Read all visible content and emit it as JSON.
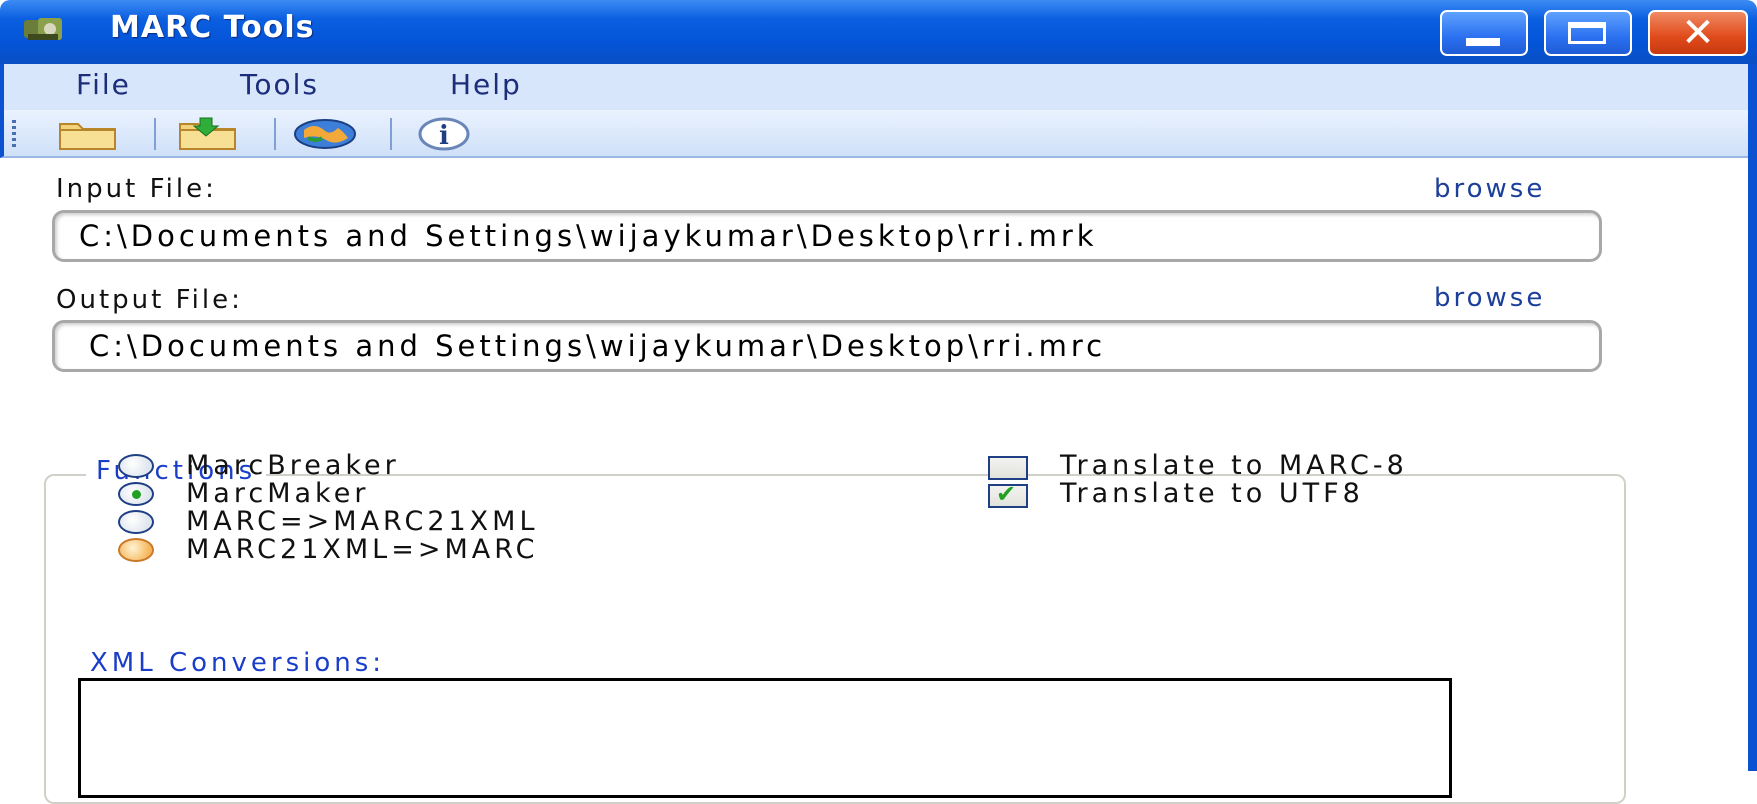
{
  "window": {
    "title": "MARC Tools",
    "close_glyph": "✕"
  },
  "menu": {
    "items": [
      "File",
      "Tools",
      "Help"
    ]
  },
  "toolbar": {
    "buttons": [
      "open-folder-icon",
      "save-folder-icon",
      "globe-icon",
      "info-icon"
    ]
  },
  "input_file": {
    "label": "Input File:",
    "browse": "browse",
    "value": "C:\\Documents and Settings\\wijaykumar\\Desktop\\rri.mrk"
  },
  "output_file": {
    "label": "Output File:",
    "browse": "browse",
    "value": "C:\\Documents and Settings\\wijaykumar\\Desktop\\rri.mrc"
  },
  "functions": {
    "title": "Functions",
    "radios": [
      {
        "label": "MarcBreaker",
        "checked": false
      },
      {
        "label": "MarcMaker",
        "checked": true
      },
      {
        "label": "MARC=>MARC21XML",
        "checked": false
      },
      {
        "label": "MARC21XML=>MARC",
        "checked": false
      }
    ],
    "checkboxes": [
      {
        "label": "Translate to MARC-8",
        "checked": false
      },
      {
        "label": "Translate to UTF8",
        "checked": true
      }
    ],
    "xml_label": "XML Conversions:"
  },
  "colors": {
    "titlebar": "#0453d6",
    "menubar": "#d7e6fb",
    "accent_text": "#1a3ec8"
  }
}
